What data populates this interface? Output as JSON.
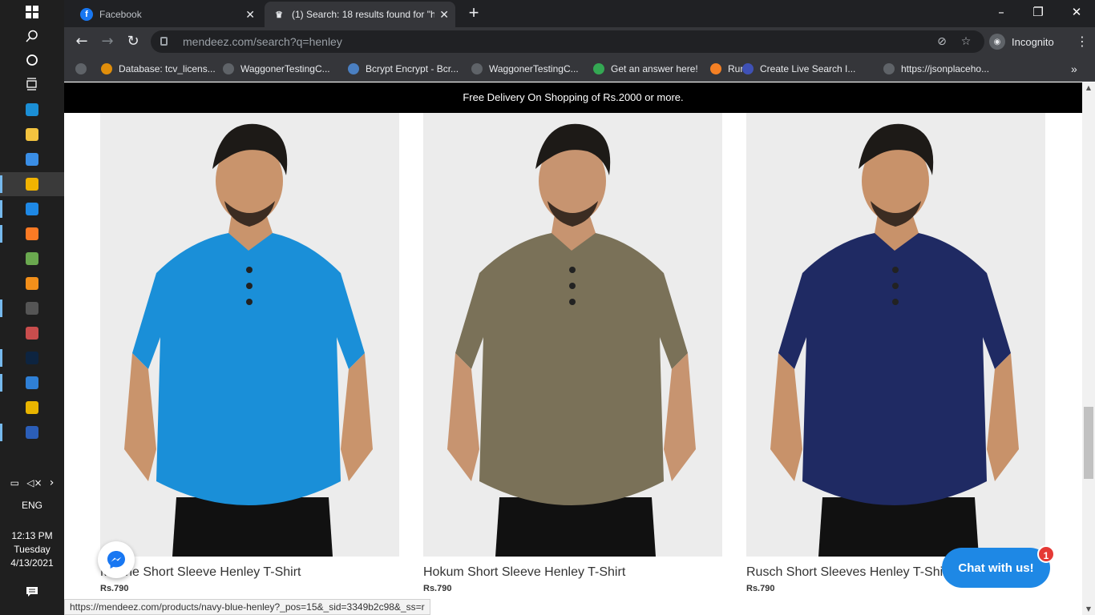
{
  "taskbar": {
    "apps": [
      {
        "name": "Microsoft Edge",
        "color": "#1b8fd6"
      },
      {
        "name": "File Explorer",
        "color": "#f3c33f"
      },
      {
        "name": "Microsoft Store",
        "color": "#3a8ee6"
      },
      {
        "name": "Google Chrome",
        "color": "#f1b300"
      },
      {
        "name": "Mail",
        "color": "#1e88e5"
      },
      {
        "name": "XAMPP",
        "color": "#fb7a24"
      },
      {
        "name": "Git",
        "color": "#6aa84f"
      },
      {
        "name": "Sublime Text",
        "color": "#f28f1a"
      },
      {
        "name": "Command Prompt",
        "color": "#555"
      },
      {
        "name": "Paint",
        "color": "#c94d4d"
      },
      {
        "name": "Photoshop",
        "color": "#0d2440"
      },
      {
        "name": "VS Code",
        "color": "#2f80d6"
      },
      {
        "name": "Slack",
        "color": "#e8b400"
      },
      {
        "name": "Word",
        "color": "#2b5eb8"
      }
    ],
    "language": "ENG",
    "time": "12:13 PM",
    "day": "Tuesday",
    "date": "4/13/2021"
  },
  "browser": {
    "tabs": [
      {
        "title": "Facebook",
        "active": false
      },
      {
        "title": "(1) Search: 18 results found for \"h",
        "active": true
      }
    ],
    "url": "mendeez.com/search?q=henley",
    "profile_label": "Incognito",
    "bookmarks": [
      {
        "label": "",
        "icon": "globe"
      },
      {
        "label": "Database: tcv_licens...",
        "icon": "pma"
      },
      {
        "label": "WaggonerTestingC...",
        "icon": "globe"
      },
      {
        "label": "Bcrypt Encrypt - Bcr...",
        "icon": "gear"
      },
      {
        "label": "WaggonerTestingC...",
        "icon": "globe"
      },
      {
        "label": "Get an answer here!",
        "icon": "green"
      },
      {
        "label": "Run",
        "icon": "stack"
      },
      {
        "label": "Create Live Search I...",
        "icon": "cloud"
      },
      {
        "label": "https://jsonplaceho...",
        "icon": "api"
      }
    ],
    "status_url": "https://mendeez.com/products/navy-blue-henley?_pos=15&_sid=3349b2c98&_ss=r"
  },
  "page": {
    "promo": "Free Delivery On Shopping of Rs.2000 or more.",
    "products": [
      {
        "name": "Marine Short Sleeve Henley T-Shirt",
        "price": "Rs.790",
        "shirt_color": "#1a8fd8",
        "skin": "#c9946c"
      },
      {
        "name": "Hokum Short Sleeve Henley T-Shirt",
        "price": "Rs.790",
        "shirt_color": "#7a7158",
        "skin": "#c79470"
      },
      {
        "name": "Rusch Short Sleeves Henley T-Shirt",
        "price": "Rs.790",
        "shirt_color": "#1f2a63",
        "skin": "#c8926a"
      }
    ],
    "chat_label": "Chat with us!",
    "chat_badge": "1"
  }
}
